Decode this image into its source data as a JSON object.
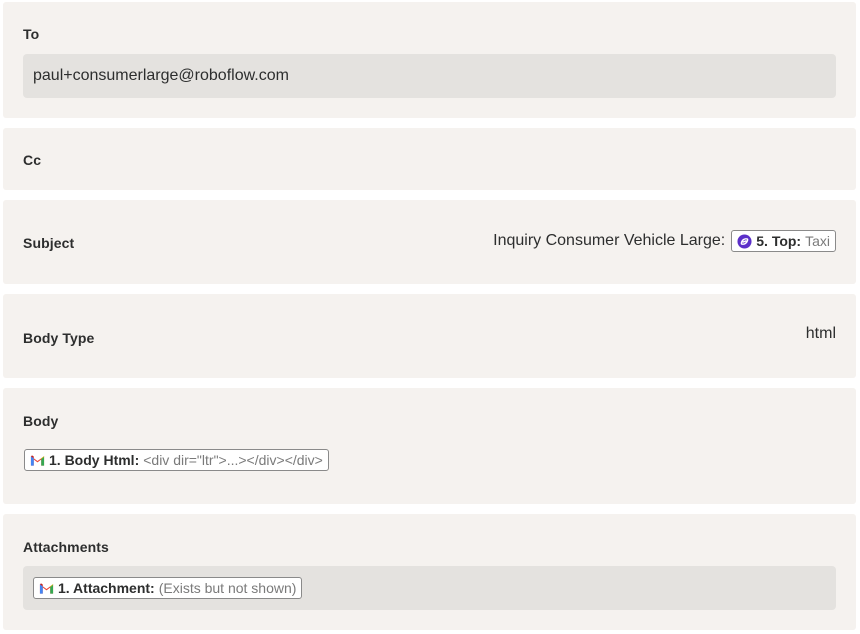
{
  "to": {
    "label": "To",
    "value": "paul+consumerlarge@roboflow.com"
  },
  "cc": {
    "label": "Cc"
  },
  "subject": {
    "label": "Subject",
    "prefix": "Inquiry Consumer Vehicle Large:",
    "pill": {
      "icon": "zapier-step-icon",
      "key": "5. Top:",
      "value": "Taxi"
    }
  },
  "body_type": {
    "label": "Body Type",
    "value": "html"
  },
  "body": {
    "label": "Body",
    "pill": {
      "icon": "gmail-icon",
      "key": "1. Body Html:",
      "value": "<div dir=\"ltr\">...></div></div>"
    }
  },
  "attachments": {
    "label": "Attachments",
    "pill": {
      "icon": "gmail-icon",
      "key": "1. Attachment:",
      "value": "(Exists but not shown)"
    }
  }
}
